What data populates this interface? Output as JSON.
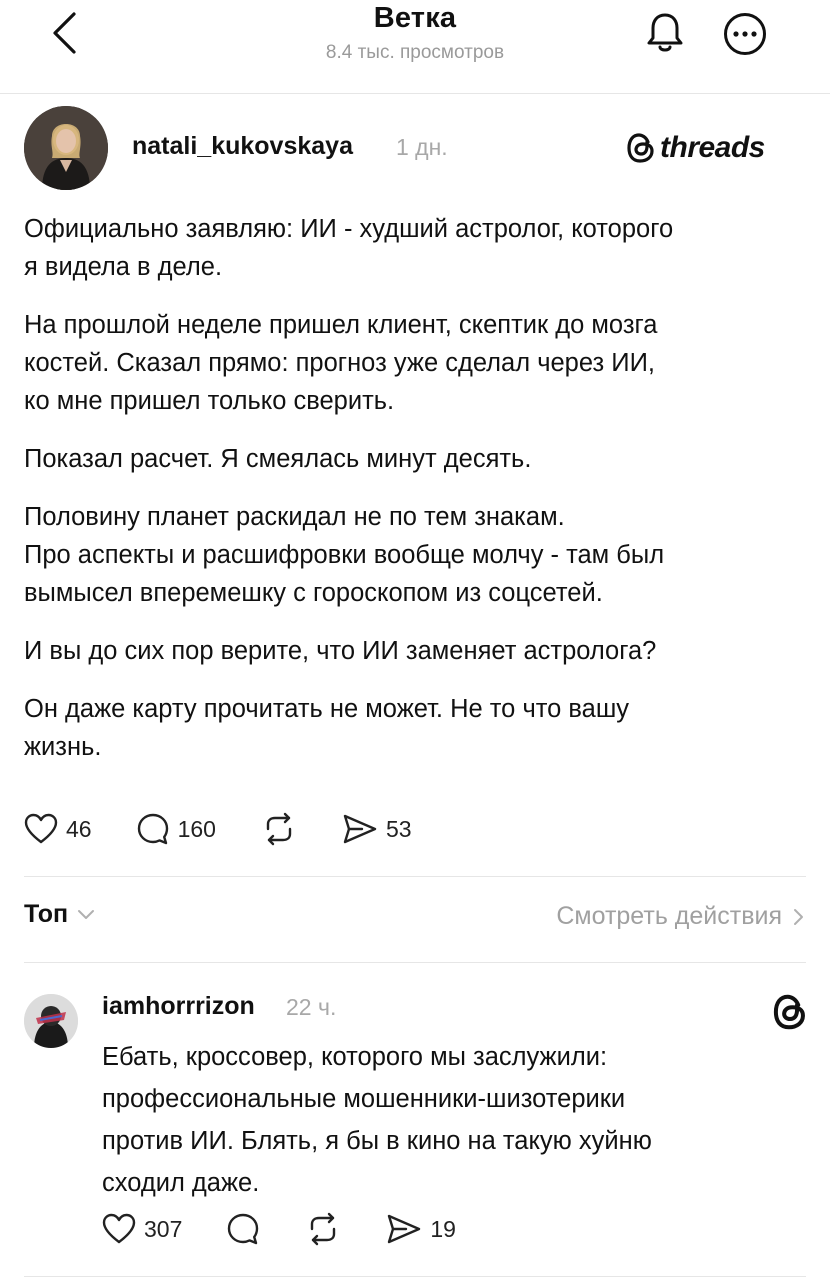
{
  "header": {
    "title": "Ветка",
    "views": "8.4 тыс. просмотров"
  },
  "post": {
    "author": "natali_kukovskaya",
    "time": "1 дн.",
    "brand": "threads",
    "paragraphs": [
      [
        "Официально заявляю: ИИ - худший астролог, которого",
        "я видела в деле."
      ],
      [
        "На прошлой неделе пришел клиент, скептик до мозга",
        "костей. Сказал прямо: прогноз уже сделал через ИИ,",
        "ко мне пришел только сверить."
      ],
      [
        "Показал расчет. Я смеялась минут десять."
      ],
      [
        "Половину планет раскидал не по тем знакам.",
        "Про аспекты и расшифровки вообще молчу - там был",
        "вымысел вперемешку с гороскопом из соцсетей."
      ],
      [
        "И вы до сих пор верите, что ИИ заменяет астролога?"
      ],
      [
        "Он даже карту прочитать не может. Не то что вашу",
        "жизнь."
      ]
    ],
    "likes": "46",
    "comments": "160",
    "shares": "53"
  },
  "sort": {
    "label": "Топ",
    "activity": "Смотреть действия"
  },
  "reply": {
    "author": "iamhorrrizon",
    "time": "22 ч.",
    "lines": [
      "Ебать, кроссовер, которого мы заслужили:",
      "профессиональные мошенники-шизотерики",
      "против ИИ. Блять, я бы в кино на такую хуйню",
      "сходил даже."
    ],
    "likes": "307",
    "shares": "19"
  },
  "colors": {
    "text": "#111111",
    "muted": "#a0a0a0",
    "divider": "#e6e6e6"
  }
}
